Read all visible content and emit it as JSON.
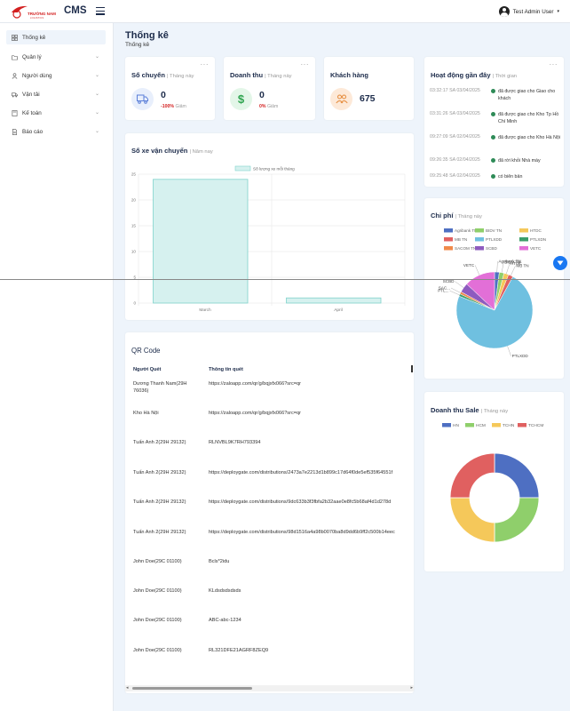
{
  "header": {
    "logo_text": "TRƯỜNG NAM",
    "logo_sub": "LOGISTICS",
    "brand": "CMS",
    "user_name": "Test Admin User"
  },
  "sidebar": {
    "items": [
      {
        "label": "Thống kê",
        "icon": "grid-icon",
        "active": true
      },
      {
        "label": "Quản lý",
        "icon": "folder-icon"
      },
      {
        "label": "Người dùng",
        "icon": "user-icon"
      },
      {
        "label": "Vận tải",
        "icon": "truck-icon"
      },
      {
        "label": "Kế toán",
        "icon": "calculator-icon"
      },
      {
        "label": "Báo cáo",
        "icon": "report-icon"
      }
    ]
  },
  "page": {
    "title": "Thống kê",
    "subtitle": "Thống kê"
  },
  "stats": [
    {
      "title": "Số chuyến",
      "period": "| Tháng này",
      "value": "0",
      "change": "-100%",
      "change_label": "Giảm",
      "icon": "truck-icon",
      "color": "#5a7ed8",
      "bg": "#e8effc"
    },
    {
      "title": "Doanh thu",
      "period": "| Tháng này",
      "value": "0",
      "change": "0%",
      "change_label": "Giảm",
      "icon": "dollar-icon",
      "color": "#2ea44f",
      "bg": "#e3f6e8"
    },
    {
      "title": "Khách hàng",
      "period": "",
      "value": "675",
      "change": "",
      "change_label": "",
      "icon": "users-icon",
      "color": "#e58a3a",
      "bg": "#fde9d8"
    }
  ],
  "activity": {
    "title": "Hoạt động gần đây",
    "period": "| Thời gian",
    "items": [
      {
        "time": "03:32:17 SA 03/04/2025",
        "text": "đã được giao cho Giao cho khách"
      },
      {
        "time": "03:31:26 SA 03/04/2025",
        "text": "đã được giao cho Kho Tp Hồ Chí Minh"
      },
      {
        "time": "09:27:09 SA 02/04/2025",
        "text": "đã được giao cho Kho Hà Nội"
      },
      {
        "time": "09:26:35 SA 02/04/2025",
        "text": "đã rời khỏi Nhà máy"
      },
      {
        "time": "09:25:48 SA 02/04/2025",
        "text": "có biên bản"
      }
    ]
  },
  "vehicle_chart": {
    "title": "Số xe vận chuyển",
    "period": "| Năm nay"
  },
  "chi_phi": {
    "title": "Chi phí",
    "period": "| Tháng này"
  },
  "sale": {
    "title": "Doanh thu Sale",
    "period": "| Tháng này"
  },
  "qr": {
    "title": "QR Code",
    "col1": "Người Quét",
    "col2": "Thông tin quét",
    "rows": [
      {
        "person": "Dương Thanh Nam(29H\n76036)",
        "info": "https://zaloapp.com/qr/g/bqjxfx066?src=qr"
      },
      {
        "person": "Kho Hà Nội",
        "info": "https://zaloapp.com/qr/g/bqjxfx066?src=qr"
      },
      {
        "person": "Tuấn Anh 2(29H 29132)",
        "info": "RLNVBL9K7RH793394"
      },
      {
        "person": "Tuấn Anh 2(29H 29132)",
        "info": "https://deploygate.com/distributions/2473a7e2213d1b899c17d64f0de5ef535f64551f"
      },
      {
        "person": "Tuấn Anh 2(29H 29132)",
        "info": "https://deploygate.com/distributions/9dc633b3f3fbfa2b32aae0e8fc5b68af4d1d278d"
      },
      {
        "person": "Tuấn Anh 2(29H 29132)",
        "info": "https://deploygate.com/distributions/98d1516a4a98b0070ba8d9dd6b9ff2c500b14eec"
      },
      {
        "person": "John Doe(29C 01100)",
        "info": "Bcls*2idu"
      },
      {
        "person": "John Doe(29C 01100)",
        "info": "KLdsdsdsdsds"
      },
      {
        "person": "John Doe(29C 01100)",
        "info": "ABC-abc-1234"
      },
      {
        "person": "John Doe(29C 01100)",
        "info": "RL321DFE21AGRF8ZEQ9"
      }
    ]
  },
  "chart_data": [
    {
      "type": "bar",
      "categories": [
        "March",
        "April"
      ],
      "series": [
        {
          "name": "Số lượng xe mỗi tháng",
          "values": [
            24,
            1
          ]
        }
      ],
      "ylim": [
        0,
        25
      ],
      "yticks": [
        0,
        5,
        10,
        15,
        20,
        25
      ],
      "grid": true,
      "legend": "top",
      "colors": {
        "fill": "#d6f1ef",
        "stroke": "#7fd3cb"
      }
    },
    {
      "type": "pie",
      "labels": [
        "Agribank TN",
        "BIDV TN",
        "HTDC",
        "MB TN",
        "PTLXDD",
        "PTLXDN",
        "SACOM TN",
        "SCBD",
        "VETC"
      ],
      "values": [
        2,
        2,
        2,
        2,
        73,
        1,
        1,
        4,
        13
      ],
      "colors": [
        "#4e6fc2",
        "#8fcf6b",
        "#f5c85a",
        "#e06060",
        "#6fc0e0",
        "#3c9e6a",
        "#f08a4b",
        "#8e5bbf",
        "#e26fd7"
      ],
      "legend": "top",
      "slice_labels": [
        "Agribank TN",
        "BIDV TN",
        "HTDC",
        "MB TN",
        "PTLXDD",
        "PTL...",
        "SAC...",
        "SCBD",
        "VETC"
      ]
    },
    {
      "type": "pie",
      "labels": [
        "HN",
        "HCM",
        "TCHN",
        "TCHCM"
      ],
      "values": [
        25,
        25,
        25,
        25
      ],
      "colors": [
        "#4e6fc2",
        "#8fcf6b",
        "#f5c85a",
        "#e06060"
      ],
      "legend": "top",
      "donut": true
    }
  ],
  "fab": {
    "icon": "chevron-down-icon"
  }
}
